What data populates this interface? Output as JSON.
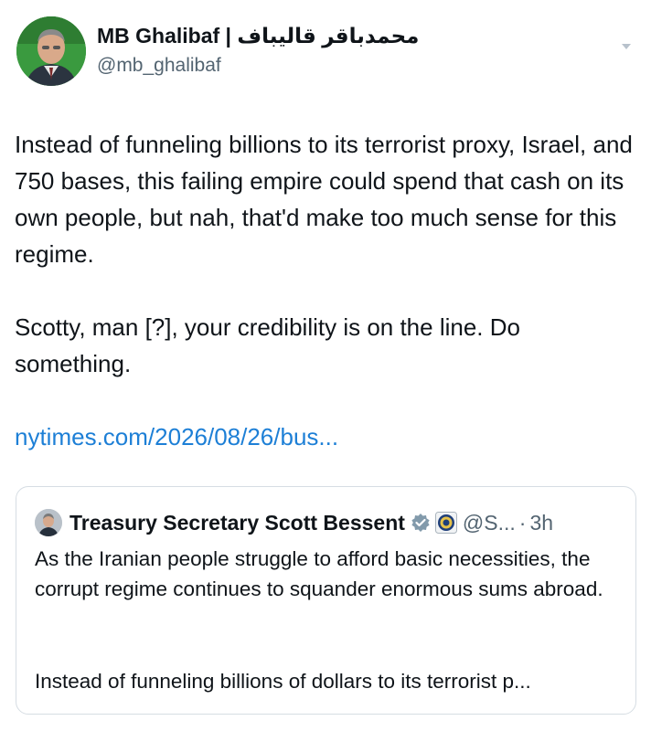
{
  "author": {
    "display_name": "MB Ghalibaf | محمدباقر قالیباف",
    "handle": "@mb_ghalibaf",
    "avatar_icon": "portrait-avatar"
  },
  "tweet": {
    "paragraph1": "Instead of funneling billions to its terrorist proxy, Israel, and 750 bases, this failing empire could spend that cash on its own people, but nah, that'd make too much sense for this regime.",
    "paragraph2": "Scotty, man [?], your credibility is on the line. Do something.",
    "link": "nytimes.com/2026/08/26/bus..."
  },
  "quoted_tweet": {
    "display_name": "Treasury Secretary Scott Bessent",
    "handle": "@S...",
    "separator": "·",
    "time": "3h",
    "paragraph1": "As the Iranian people struggle to afford basic necessities, the corrupt regime continues to squander enormous sums abroad.",
    "paragraph2": "Instead of funneling billions of dollars to its terrorist p..."
  },
  "colors": {
    "link": "#1d7fd6",
    "muted": "#536471",
    "border": "#d6dde3"
  }
}
